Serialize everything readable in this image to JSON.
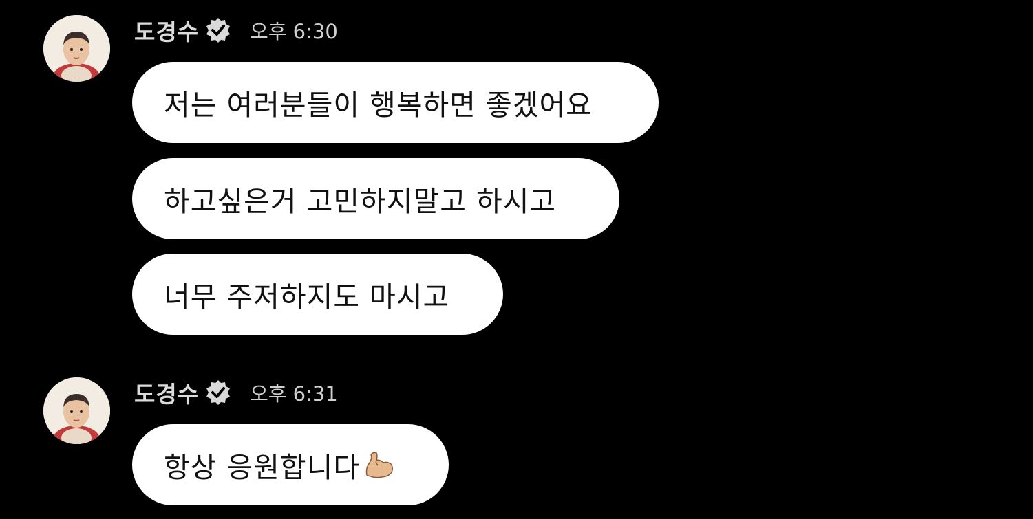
{
  "messages": [
    {
      "sender": "도경수",
      "time": "오후 6:30",
      "bubbles": [
        "저는 여러분들이 행복하면 좋겠어요",
        "하고싶은거 고민하지말고 하시고",
        "너무 주저하지도 마시고"
      ]
    },
    {
      "sender": "도경수",
      "time": "오후 6:31",
      "bubbles": [
        "항상 응원합니다"
      ],
      "trailing_icon": "flexed-biceps-emoji"
    }
  ],
  "colors": {
    "background": "#000000",
    "bubble": "#ffffff",
    "bubble_text": "#111111",
    "name_text": "#dcdcdc",
    "time_text": "#cfcfcf",
    "verified_badge": "#d9d9d9"
  }
}
